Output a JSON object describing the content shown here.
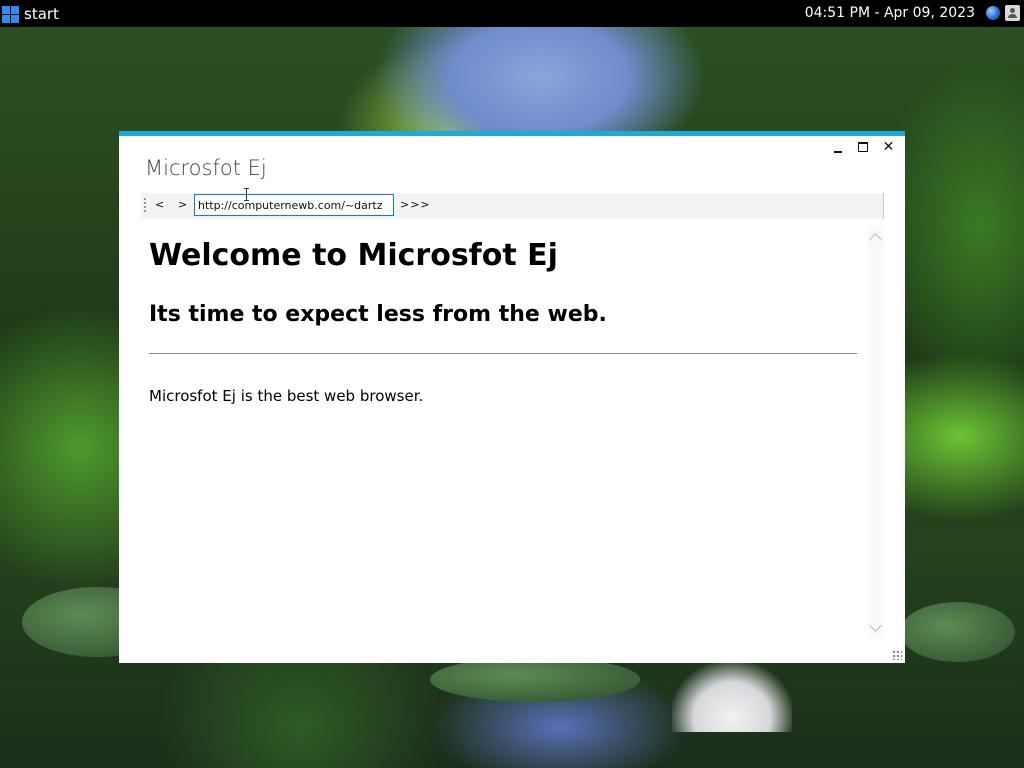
{
  "taskbar": {
    "start_label": "start",
    "clock": "04:51 PM - Apr 09, 2023",
    "icons": [
      "windows-logo-icon",
      "globe-icon",
      "user-icon"
    ],
    "accent": "#2f8cf0"
  },
  "window": {
    "title": "Microsfot Ej",
    "accent": "#1eaad3",
    "controls": [
      "minimize",
      "maximize",
      "close"
    ],
    "close_glyph": "✕"
  },
  "toolbar": {
    "back_label": "<",
    "forward_label": ">",
    "url_value": "http://computernewb.com/~dartz",
    "go_label": ">>>"
  },
  "page": {
    "heading": "Welcome to Microsfot Ej",
    "subheading": "Its time to expect less from the web.",
    "body": "Microsfot Ej is the best web browser."
  }
}
